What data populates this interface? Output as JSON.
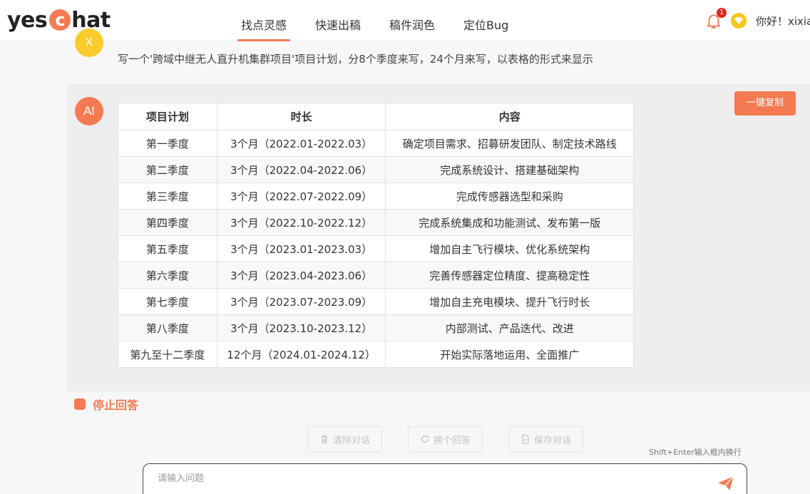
{
  "header": {
    "logo_left": "yes",
    "logo_badge": "c",
    "logo_right": "hat",
    "nav": [
      {
        "label": "找点灵感",
        "active": true
      },
      {
        "label": "快速出稿",
        "active": false
      },
      {
        "label": "稿件润色",
        "active": false
      },
      {
        "label": "定位Bug",
        "active": false
      }
    ],
    "notification_count": "1",
    "greeting": "你好！xixia"
  },
  "conversation": {
    "user_avatar": "X",
    "user_message": "写一个'跨域中继无人直升机集群项目'项目计划，分8个季度来写，24个月来写，以表格的形式来显示",
    "ai_avatar": "AI",
    "copy_label": "一键复制",
    "table": {
      "headers": [
        "项目计划",
        "时长",
        "内容"
      ],
      "rows": [
        [
          "第一季度",
          "3个月（2022.01-2022.03）",
          "确定项目需求、招募研发团队、制定技术路线"
        ],
        [
          "第二季度",
          "3个月（2022.04-2022.06）",
          "完成系统设计、搭建基础架构"
        ],
        [
          "第三季度",
          "3个月（2022.07-2022.09）",
          "完成传感器选型和采购"
        ],
        [
          "第四季度",
          "3个月（2022.10-2022.12）",
          "完成系统集成和功能测试、发布第一版"
        ],
        [
          "第五季度",
          "3个月（2023.01-2023.03）",
          "增加自主飞行模块、优化系统架构"
        ],
        [
          "第六季度",
          "3个月（2023.04-2023.06）",
          "完善传感器定位精度、提高稳定性"
        ],
        [
          "第七季度",
          "3个月（2023.07-2023.09）",
          "增加自主充电模块、提升飞行时长"
        ],
        [
          "第八季度",
          "3个月（2023.10-2023.12）",
          "内部测试、产品迭代、改进"
        ],
        [
          "第九至十二季度",
          "12个月（2024.01-2024.12）",
          "开始实际落地运用、全面推广"
        ]
      ]
    }
  },
  "controls": {
    "stop_label": "停止回答",
    "clear_label": "清除对话",
    "regenerate_label": "换个回答",
    "save_label": "保存对话",
    "hint": "Shift+Enter输入框内换行",
    "input_placeholder": "请输入问题"
  },
  "colors": {
    "accent": "#f47a52",
    "user_avatar": "#fccb2b",
    "badge": "#e2231a"
  }
}
